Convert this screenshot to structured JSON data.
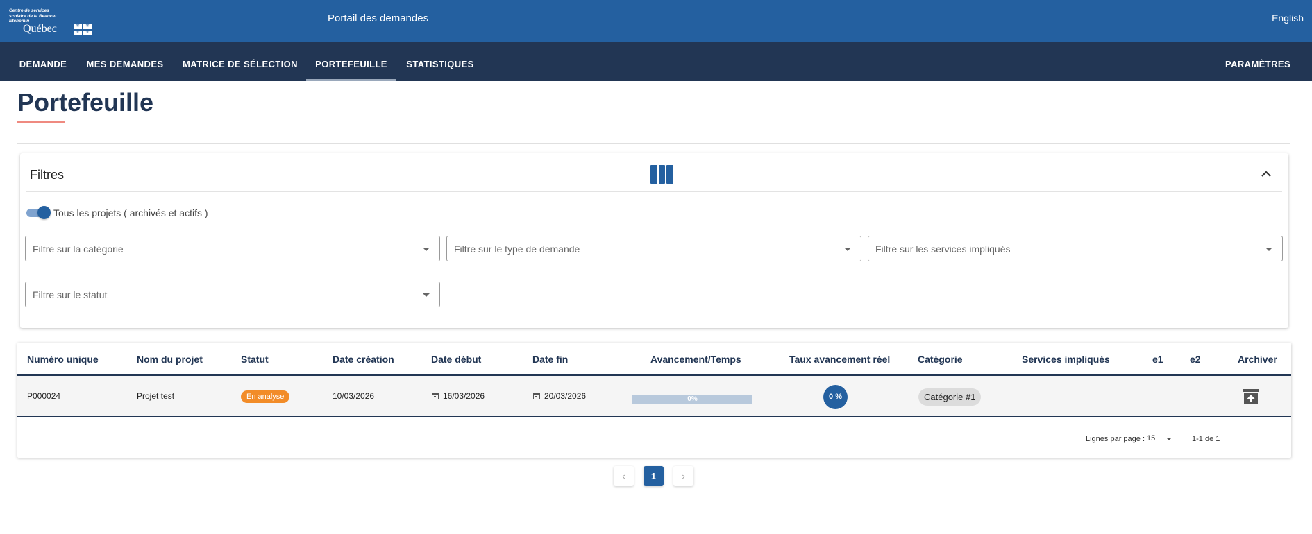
{
  "header": {
    "org_name": "Centre de services scolaire de la Beauce-Etchemin",
    "logo_text": "Québec",
    "portal_title": "Portail des demandes",
    "language": "English"
  },
  "nav": {
    "tabs": [
      {
        "label": "DEMANDE"
      },
      {
        "label": "MES DEMANDES"
      },
      {
        "label": "MATRICE DE SÉLECTION"
      },
      {
        "label": "PORTEFEUILLE",
        "active": true
      },
      {
        "label": "STATISTIQUES"
      }
    ],
    "settings": "PARAMÈTRES"
  },
  "page": {
    "title": "Portefeuille"
  },
  "filters": {
    "title": "Filtres",
    "toggle_label": "Tous les projets ( archivés et actifs )",
    "toggle_on": true,
    "category_placeholder": "Filtre sur la catégorie",
    "type_placeholder": "Filtre sur le type de demande",
    "services_placeholder": "Filtre sur les services impliqués",
    "status_placeholder": "Filtre sur le statut"
  },
  "table": {
    "columns": [
      "Numéro unique",
      "Nom du projet",
      "Statut",
      "Date création",
      "Date début",
      "Date fin",
      "Avancement/Temps",
      "Taux avancement réel",
      "Catégorie",
      "Services impliqués",
      "e1",
      "e2",
      "Archiver"
    ],
    "rows": [
      {
        "number": "P000024",
        "name": "Projet test",
        "status": "En analyse",
        "created": "10/03/2026",
        "start": "16/03/2026",
        "end": "20/03/2026",
        "progress_label": "0%",
        "progress_value": 0,
        "real_rate": "0 %",
        "category": "Catégorie #1",
        "services": "",
        "e1": "",
        "e2": ""
      }
    ],
    "rows_per_page_label": "Lignes par page :",
    "rows_per_page": "15",
    "range": "1-1 de 1"
  },
  "pagination": {
    "prev": "‹",
    "current": "1",
    "next": "›"
  },
  "colors": {
    "header_blue": "#2460a0",
    "nav_navy": "#223654",
    "status_orange": "#f28c28",
    "accent_underline": "#ef8a80"
  }
}
